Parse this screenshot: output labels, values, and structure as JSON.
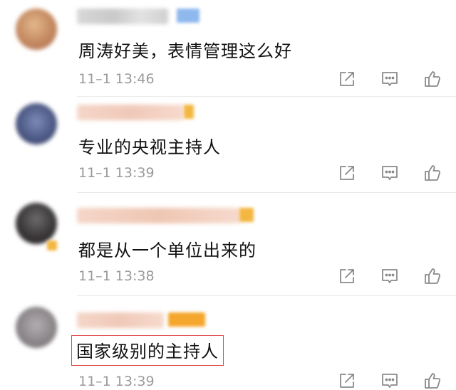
{
  "comments": [
    {
      "text": "周涛好美，表情管理这么好",
      "time": "11–1 13:46",
      "highlighted": false,
      "badge_color": "#8fb8ee",
      "avatar_color": "#c8906a"
    },
    {
      "text": "专业的央视主持人",
      "time": "11–1 13:39",
      "highlighted": false,
      "badge_color": "#f3b640",
      "avatar_color": "#5a6790"
    },
    {
      "text": "都是从一个单位出来的",
      "time": "11–1 13:38",
      "highlighted": false,
      "badge_color": "#f3b640",
      "avatar_color": "#3d3a3c"
    },
    {
      "text": "国家级别的主持人",
      "time": "11–1 13:39",
      "highlighted": true,
      "badge_color": "#f5a62c",
      "avatar_color": "#8f8a8d"
    }
  ],
  "icons": [
    "share-icon",
    "comment-icon",
    "like-icon"
  ],
  "colors": {
    "highlight_border": "#e04a4a",
    "time_text": "#9a9a9a",
    "icon_stroke": "#8a8a8a"
  }
}
